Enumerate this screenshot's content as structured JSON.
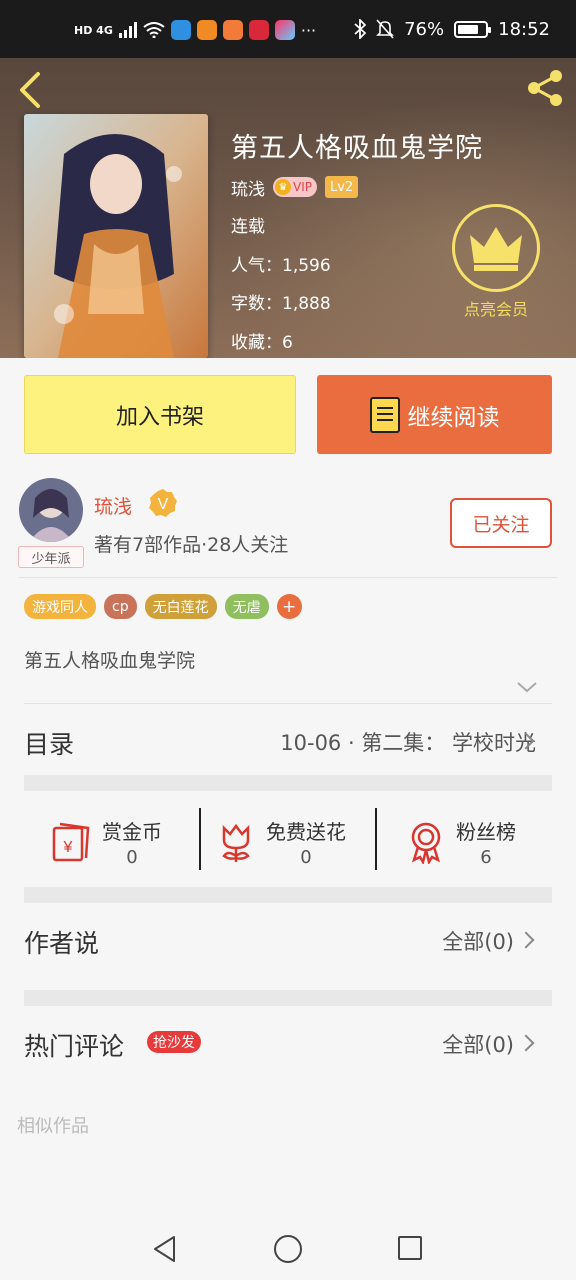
{
  "status_bar": {
    "network": "HD 4G",
    "battery": "76%",
    "battery_level": 0.76,
    "time": "18:52",
    "more": "···"
  },
  "book": {
    "title": "第五人格吸血鬼学院",
    "author": "琉浅",
    "vip": "VIP",
    "level": "Lv2",
    "status": "连载",
    "popularity": "人气：1,596",
    "word_count": "字数：1,888",
    "favorites": "收藏：6"
  },
  "member": {
    "label": "点亮会员"
  },
  "actions": {
    "add_to_shelf": "加入书架",
    "continue_reading": "继续阅读"
  },
  "author_card": {
    "name": "琉浅",
    "badge": "V",
    "tag": "少年派",
    "meta": "著有7部作品·28人关注",
    "follow_label": "已关注"
  },
  "tags": [
    {
      "label": "游戏同人",
      "color": "#f3b33d"
    },
    {
      "label": "cp",
      "color": "#c9745a"
    },
    {
      "label": "无白莲花",
      "color": "#d0a13b"
    },
    {
      "label": "无虐",
      "color": "#8fbf5e"
    }
  ],
  "tag_add": "+",
  "description": "第五人格吸血鬼学院",
  "catalog": {
    "label": "目录",
    "latest": "10-06 · 第二集：  学校时光"
  },
  "stats": [
    {
      "label": "赏金币",
      "value": "0",
      "icon": "envelope-coin-icon"
    },
    {
      "label": "免费送花",
      "value": "0",
      "icon": "flower-icon"
    },
    {
      "label": "粉丝榜",
      "value": "6",
      "icon": "medal-icon"
    }
  ],
  "author_says": {
    "label": "作者说",
    "all": "全部(0)"
  },
  "hot_comments": {
    "label": "热门评论",
    "badge": "抢沙发",
    "all": "全部(0)"
  },
  "similar": {
    "label": "相似作品"
  },
  "colors": {
    "accent_orange": "#ea6d40",
    "shelf_yellow": "#fcf27d",
    "author_red": "#e0533a"
  }
}
